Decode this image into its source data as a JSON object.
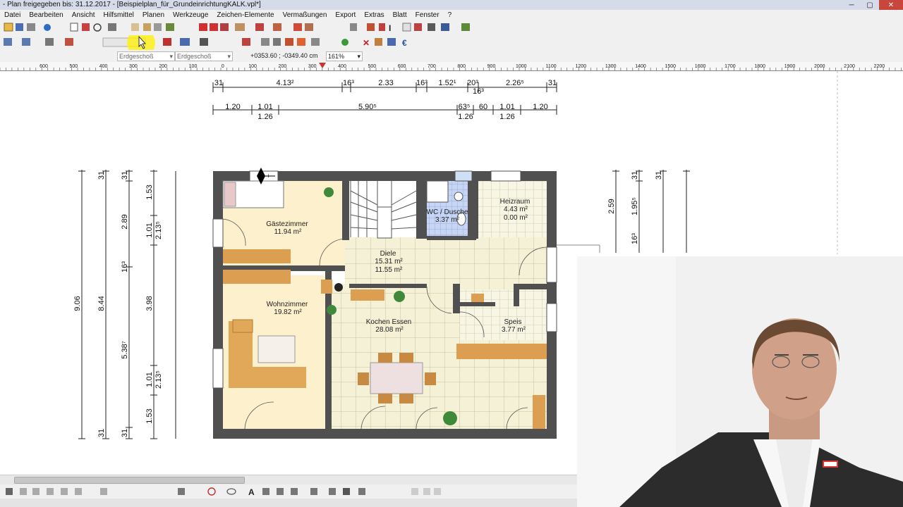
{
  "window": {
    "title": "- Plan freigegeben bis: 31.12.2017 - [Beispielplan_für_GrundeinrichtungKALK.vpl*]",
    "controls": [
      "─",
      "▢",
      "✕"
    ]
  },
  "menu": [
    "Datei",
    "Bearbeiten",
    "Ansicht",
    "Hilfsmittel",
    "Planen",
    "Werkzeuge",
    "Zeichen-Elemente",
    "Vermaßungen",
    "Export",
    "Extras",
    "Blatt",
    "Fenster",
    "?"
  ],
  "status": {
    "layer": "Erdgeschoß",
    "floor": "Erdgeschoß",
    "coordinates": "+0353.60 ; -0349.40 cm",
    "zoom": "161%"
  },
  "ruler_labels": [
    "600",
    "500",
    "400",
    "300",
    "200",
    "100",
    "0",
    "100",
    "200",
    "300",
    "400",
    "500",
    "600",
    "700",
    "800",
    "900",
    "1000",
    "1100",
    "1200",
    "1300",
    "1400",
    "1500",
    "1600",
    "1700",
    "1800",
    "1900",
    "2000",
    "2100",
    "2200"
  ],
  "dimensions": {
    "top_row1": [
      "31",
      "4.13²",
      "16³",
      "2.33",
      "16³",
      "1.52¹",
      "20³",
      "16³",
      "2.26⁵",
      "31"
    ],
    "top_row2": [
      "1.20",
      "1.01",
      "1.26",
      "5.90⁵",
      "63⁵",
      "1.26",
      "60",
      "1.01",
      "1.26",
      "1.20"
    ],
    "left_outer": [
      "9.06",
      "8.44",
      "31",
      "31"
    ],
    "left_mid": [
      "31",
      "2.89",
      "16³",
      "5.38⁷",
      "31"
    ],
    "left_inner": [
      "1.53",
      "1.01",
      "3.98",
      "1.01",
      "1.53",
      "2.13⁵",
      "2.13⁵"
    ],
    "right": [
      "2.59",
      "31",
      "1.95⁵",
      "16³",
      "31"
    ]
  },
  "rooms": [
    {
      "name": "Gästezimmer",
      "area": "11.94 m²"
    },
    {
      "name": "Wohnzimmer",
      "area": "19.82 m²"
    },
    {
      "name": "Diele",
      "area": "15.31 m²",
      "area2": "11.55 m²"
    },
    {
      "name": "WC / Dusche",
      "area": "3.37 m²"
    },
    {
      "name": "Heizraum",
      "area": "4.43 m²",
      "area2": "0.00 m²"
    },
    {
      "name": "Kochen Essen",
      "area": "28.08 m²"
    },
    {
      "name": "Speis",
      "area": "3.77 m²"
    }
  ],
  "colors": {
    "wall": "#505050",
    "floor_warm": "#fdf0cc",
    "tile": "#f4f0d6",
    "bath_tile": "#c7d5f5",
    "furniture": "#dc9f52",
    "highlight": "#fff200"
  }
}
